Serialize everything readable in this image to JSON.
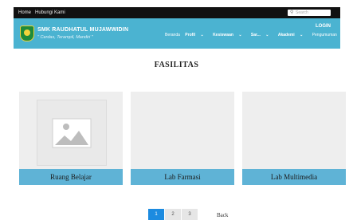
{
  "document": {
    "title": "fasilitas"
  },
  "topbar": {
    "links": [
      "Home",
      "Hubungi Kami"
    ],
    "search_placeholder": "Search"
  },
  "header": {
    "school_name": "SMK RAUDHATUL MUJAWWIDIN",
    "motto": "\" Cerdas, Terampil, Mandiri \"",
    "nav": [
      "Beranda",
      "Profil",
      "Kesiswaan",
      "Sar...",
      "Akademi",
      "Pengumuman"
    ],
    "login_label": "LOGIN"
  },
  "main": {
    "section_title": "FASILITAS",
    "cards": [
      {
        "caption": "Ruang Belajar",
        "has_placeholder_image": true
      },
      {
        "caption": "Lab Farmasi",
        "has_placeholder_image": false
      },
      {
        "caption": "Lab Multimedia",
        "has_placeholder_image": false
      }
    ]
  },
  "pagination": {
    "pages": [
      "1",
      "2",
      "3"
    ],
    "active_page": "1",
    "back_label": "Back"
  },
  "colors": {
    "header": "#4bb3d1",
    "caption_bar": "#5fb3d6",
    "active_page": "#1c8be0",
    "topbar": "#111111"
  }
}
